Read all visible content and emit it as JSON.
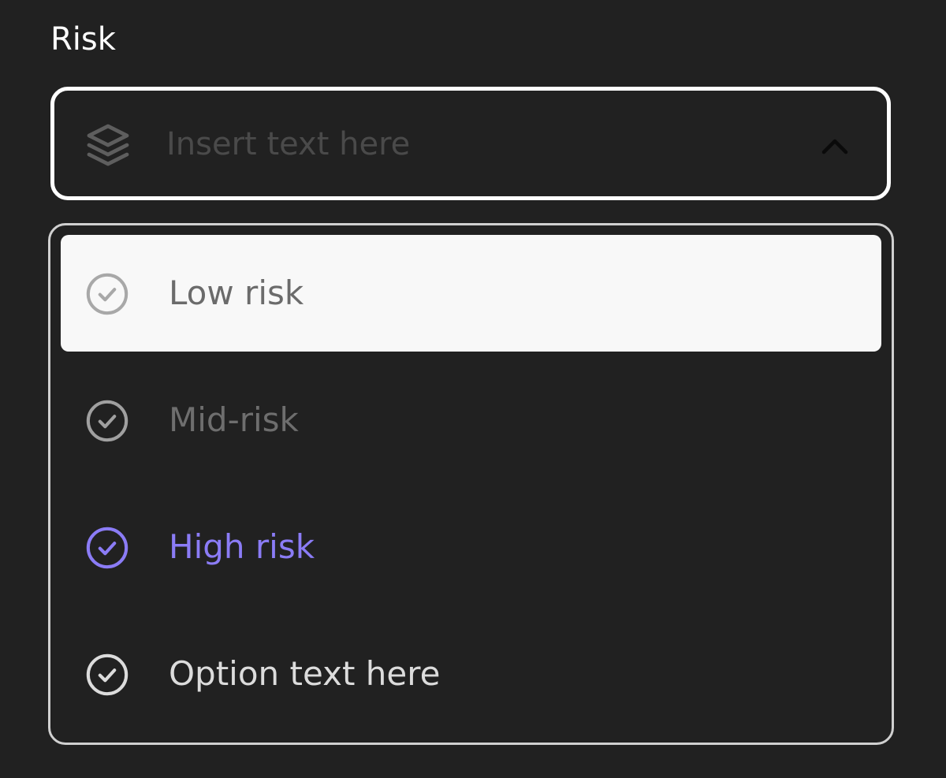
{
  "field": {
    "label": "Risk"
  },
  "select": {
    "placeholder": "Insert text here",
    "leading_icon": "layers-icon",
    "trailing_icon": "chevron-up-icon",
    "expanded": true
  },
  "options": [
    {
      "label": "Low risk",
      "state": "hovered",
      "icon": "check-circle-icon",
      "color": "#6b6b6b",
      "icon_color": "#a8a8a8"
    },
    {
      "label": "Mid-risk",
      "state": "disabled",
      "icon": "check-circle-icon",
      "color": "#6e6e6e",
      "icon_color": "#a0a0a0"
    },
    {
      "label": "High risk",
      "state": "selected",
      "icon": "check-circle-icon",
      "color": "#8b7cf6",
      "icon_color": "#8b7cf6"
    },
    {
      "label": "Option text here",
      "state": "default",
      "icon": "check-circle-icon",
      "color": "#dcdcdc",
      "icon_color": "#dcdcdc"
    }
  ],
  "colors": {
    "background": "#212121",
    "border": "#ffffff",
    "accent": "#8b7cf6",
    "highlight_row": "#f8f8f8"
  }
}
